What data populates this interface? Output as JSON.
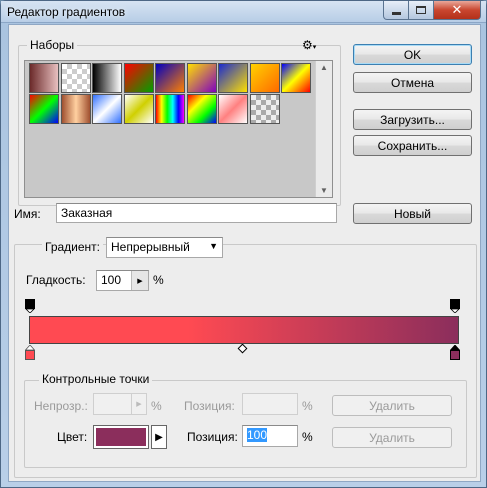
{
  "window": {
    "title": "Редактор градиентов",
    "close_glyph": "✕"
  },
  "presets": {
    "legend": "Наборы",
    "settings_icon": "gear-icon",
    "swatches": [
      "linear-gradient(to right,#6b2a2a,#e8c0c0)",
      "repeating-conic-gradient(#ccc 0 25%,#fff 0 50%)",
      "linear-gradient(to right,#000,#fff)",
      "linear-gradient(135deg,#ff0000,#00a000)",
      "linear-gradient(135deg,#0000c0,#ff8000)",
      "linear-gradient(135deg,#ffe000,#8000c0)",
      "linear-gradient(135deg,#1a2bd0,#ffe000)",
      "linear-gradient(135deg,#ffd200,#ff6a00)",
      "linear-gradient(135deg,#0000ff,#ffff00,#ff0000)",
      "linear-gradient(135deg,#ff0000,#00ff00,#0000ff)",
      "linear-gradient(to right,#a05030,#ffd0a0,#a05030)",
      "linear-gradient(135deg,#3070ff,#ffffff,#3070ff)",
      "linear-gradient(135deg,#ffffff,#d0d000,#ffffff)",
      "linear-gradient(to right,#ff0000,#ffff00,#00ff00,#00ffff,#0000ff,#ff00ff)",
      "linear-gradient(135deg,#ff0000,#ffff00,#00ff00,#0000ff)",
      "linear-gradient(135deg,#ffffff,#ff8080,#ffffff)",
      "repeating-conic-gradient(#aaa 0 25%,#eee 0 50%)"
    ]
  },
  "buttons": {
    "ok": "OK",
    "cancel": "Отмена",
    "load": "Загрузить...",
    "save": "Сохранить...",
    "new": "Новый"
  },
  "name": {
    "label": "Имя:",
    "value": "Заказная"
  },
  "gradient": {
    "type_label": "Градиент:",
    "type_value": "Непрерывный",
    "smoothness_label": "Гладкость:",
    "smoothness_value": "100",
    "smoothness_unit": "%",
    "left_color": "#ff4a52",
    "right_color": "#8b2e5c"
  },
  "stops": {
    "legend": "Контрольные точки",
    "opacity_label": "Непрозр.:",
    "opacity_unit": "%",
    "opacity_pos_label": "Позиция:",
    "opacity_pos_unit": "%",
    "opacity_delete": "Удалить",
    "color_label": "Цвет:",
    "color_value": "#8b2e5c",
    "color_pos_label": "Позиция:",
    "color_pos_value": "100",
    "color_pos_unit": "%",
    "color_delete": "Удалить"
  }
}
